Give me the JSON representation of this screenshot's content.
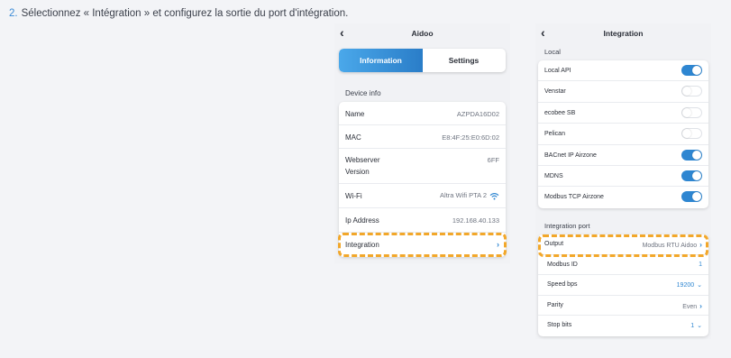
{
  "instruction": {
    "step_number": "2.",
    "text": "Sélectionnez « Intégration » et configurez la sortie du port d'intégration."
  },
  "aidoo_screen": {
    "title": "Aidoo",
    "back_icon": "chevron-left-icon",
    "tabs": [
      {
        "label": "Information",
        "active": true
      },
      {
        "label": "Settings",
        "active": false
      }
    ],
    "section_label": "Device info",
    "rows": {
      "name": {
        "label": "Name",
        "value": "AZPDA16D02"
      },
      "mac": {
        "label": "MAC",
        "value": "E8:4F:25:E0:6D:02"
      },
      "webserver": {
        "label_line1": "Webserver",
        "label_line2": "Version",
        "value": "6FF"
      },
      "wifi": {
        "label": "Wi-Fi",
        "value": "Altra Wifi PTA 2",
        "icon": "wifi-icon"
      },
      "ip": {
        "label": "Ip Address",
        "value": "192.168.40.133"
      },
      "integration": {
        "label": "Integration",
        "icon": "chevron-right-icon"
      }
    }
  },
  "integration_screen": {
    "title": "Integration",
    "back_icon": "chevron-left-icon",
    "local_label": "Local",
    "local_items": [
      {
        "label": "Local API",
        "enabled": true
      },
      {
        "label": "Venstar",
        "enabled": false
      },
      {
        "label": "ecobee SB",
        "enabled": false
      },
      {
        "label": "Pelican",
        "enabled": false
      },
      {
        "label": "BACnet IP Airzone",
        "enabled": true
      },
      {
        "label": "MDNS",
        "enabled": true
      },
      {
        "label": "Modbus TCP Airzone",
        "enabled": true
      }
    ],
    "port_label": "Integration port",
    "port_rows": {
      "output": {
        "label": "Output",
        "value": "Modbus RTU Aidoo"
      },
      "modbus_id": {
        "label": "Modbus ID",
        "value": "1"
      },
      "speed": {
        "label": "Speed bps",
        "value": "19200"
      },
      "parity": {
        "label": "Parity",
        "value": "Even"
      },
      "stop_bits": {
        "label": "Stop bits",
        "value": "1"
      }
    }
  },
  "colors": {
    "accent": "#2e86d1",
    "highlight": "#f2a72a",
    "tab_gradient_start": "#4aa8ea",
    "tab_gradient_end": "#2a7dc8"
  }
}
